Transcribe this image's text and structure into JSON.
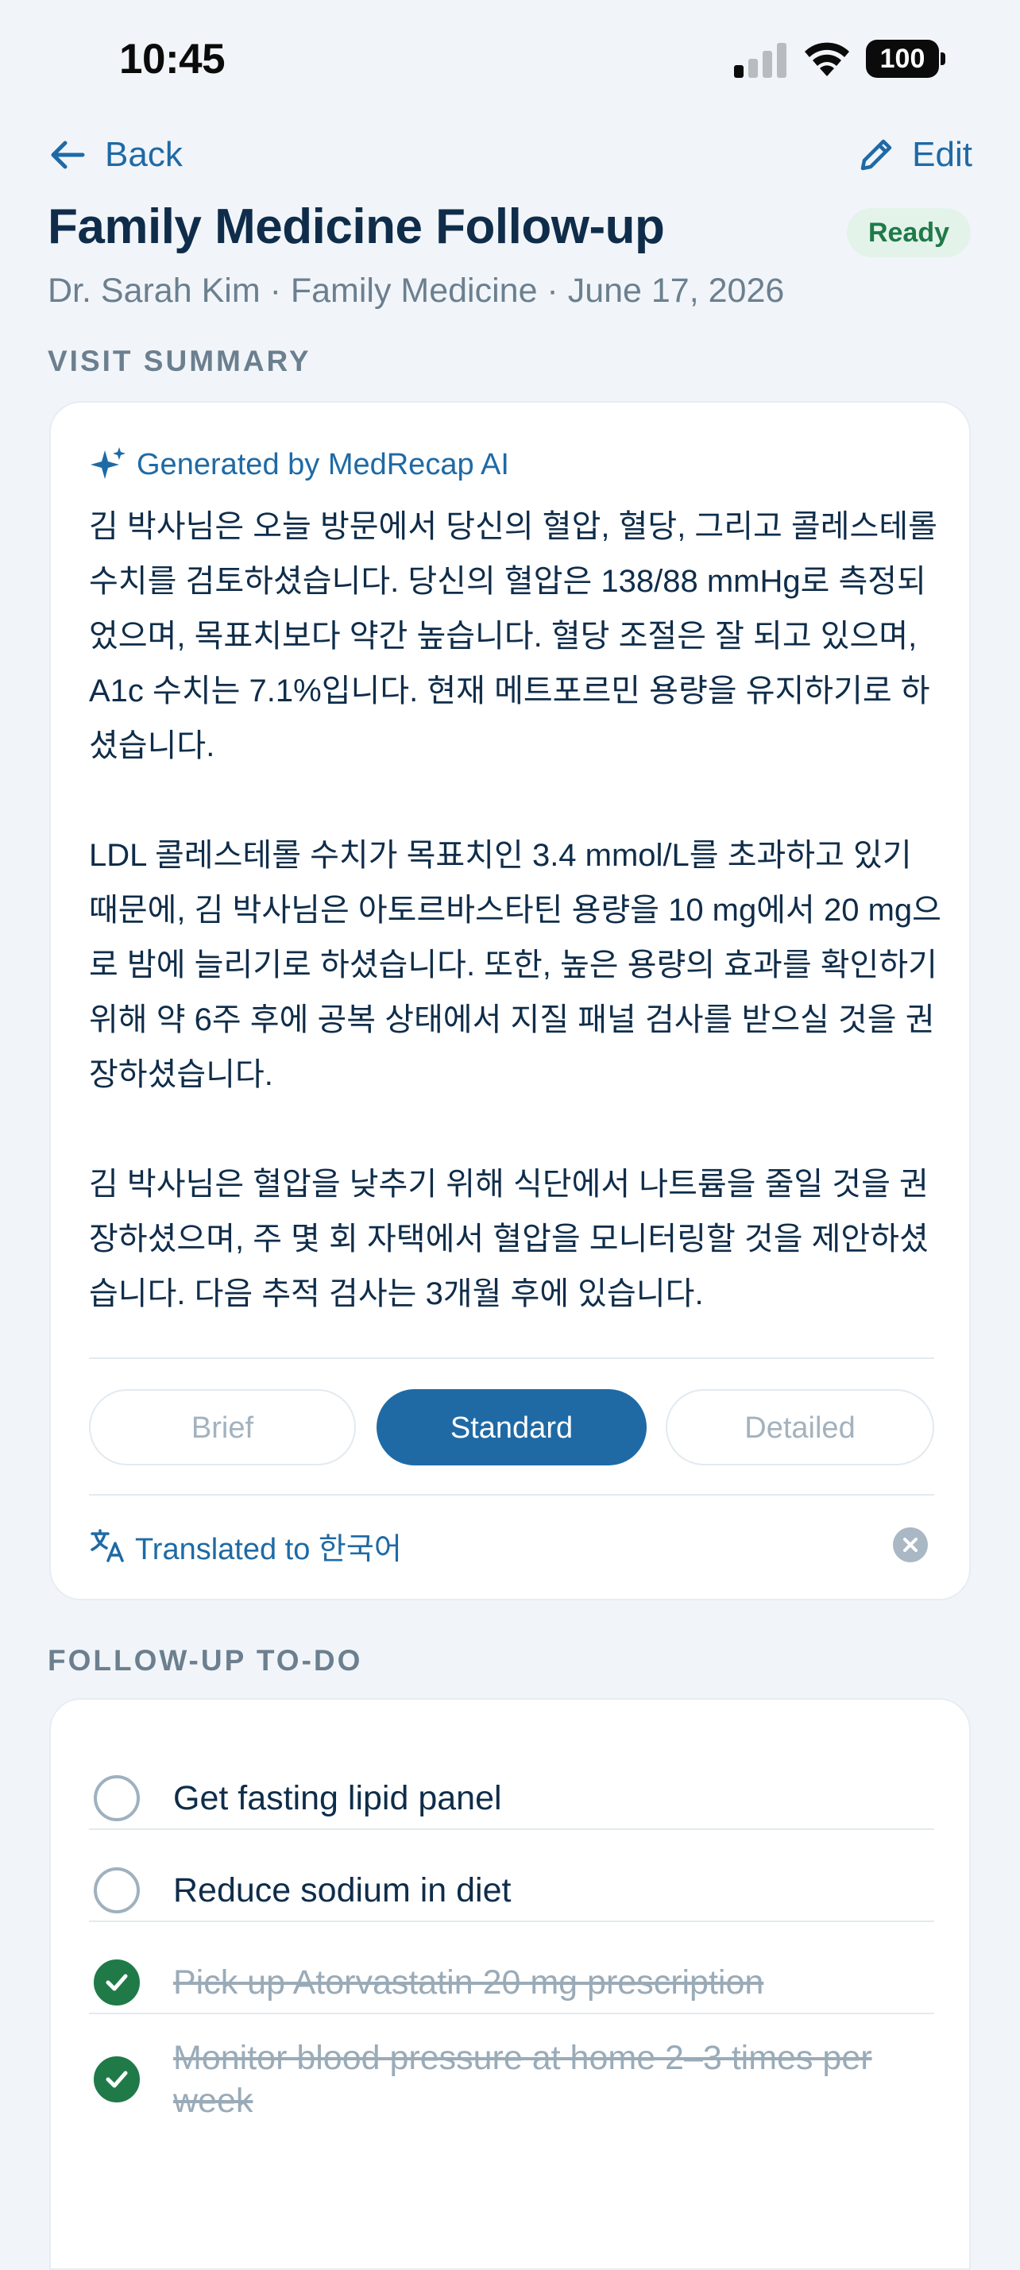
{
  "status_bar": {
    "time": "10:45",
    "battery": "100"
  },
  "nav": {
    "back_label": "Back",
    "edit_label": "Edit"
  },
  "visit": {
    "title": "Family Medicine Follow-up",
    "status": "Ready",
    "subtitle": "Dr. Sarah Kim · Family Medicine · June 17, 2026"
  },
  "summary": {
    "section_label": "VISIT SUMMARY",
    "ai_label": "Generated by MedRecap AI",
    "paragraphs": [
      "김 박사님은 오늘 방문에서 당신의 혈압, 혈당, 그리고 콜레스테롤 수치를 검토하셨습니다. 당신의 혈압은 138/88 mmHg로 측정되었으며, 목표치보다 약간 높습니다. 혈당 조절은 잘 되고 있으며, A1c 수치는 7.1%입니다. 현재 메트포르민 용량을 유지하기로 하셨습니다.",
      "LDL 콜레스테롤 수치가 목표치인 3.4 mmol/L를 초과하고 있기 때문에, 김 박사님은 아토르바스타틴 용량을 10 mg에서 20 mg으로 밤에 늘리기로 하셨습니다. 또한, 높은 용량의 효과를 확인하기 위해 약 6주 후에 공복 상태에서 지질 패널 검사를 받으실 것을 권장하셨습니다.",
      "김 박사님은 혈압을 낮추기 위해 식단에서 나트륨을 줄일 것을 권장하셨으며, 주 몇 회 자택에서 혈압을 모니터링할 것을 제안하셨습니다. 다음 추적 검사는 3개월 후에 있습니다."
    ],
    "detail_levels": [
      "Brief",
      "Standard",
      "Detailed"
    ],
    "selected_level": "Standard",
    "translation_label": "Translated to 한국어"
  },
  "todo": {
    "section_label": "FOLLOW-UP TO-DO",
    "items": [
      {
        "label": "Get fasting lipid panel",
        "done": false
      },
      {
        "label": "Reduce sodium in diet",
        "done": false
      },
      {
        "label": "Pick up Atorvastatin 20 mg prescription",
        "done": true
      },
      {
        "label": "Monitor blood pressure at home 2–3 times per week",
        "done": true
      }
    ]
  },
  "colors": {
    "accent": "#1f6aa5",
    "success": "#1f7a48",
    "background": "#f1f5f9",
    "text": "#0f2d4a",
    "muted": "#6b7f8f"
  }
}
